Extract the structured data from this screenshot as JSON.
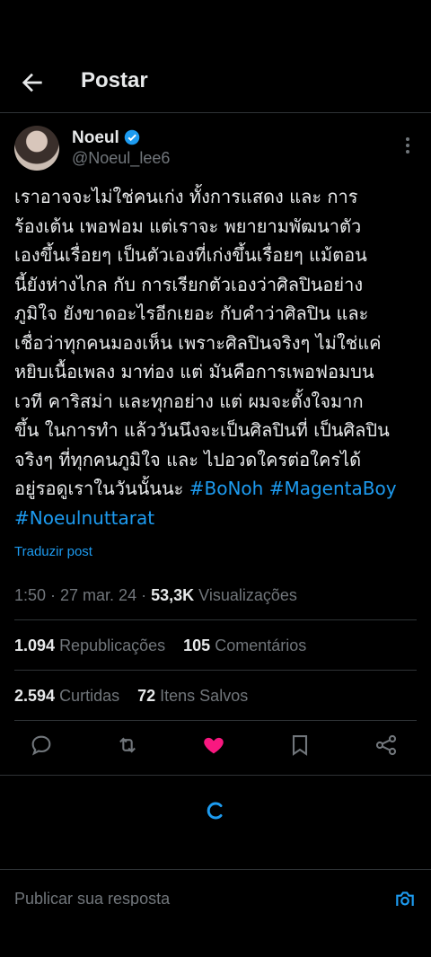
{
  "header": {
    "title": "Postar"
  },
  "author": {
    "name": "Noeul",
    "handle": "@Noeul_lee6"
  },
  "tweet": {
    "lines": [
      "เราอาจจะไม่ใช่คนเก่ง ทั้งการแสดง และ การ",
      "ร้องเต้น เพอฟอม แต่เราจะ พยายามพัฒนาตัว",
      "เองขึ้นเรื่อยๆ เป็นตัวเองที่เก่งขึ้นเรื่อยๆ แม้ตอน",
      "นี้ยังห่างไกล กับ การเรียกตัวเองว่าศิลปินอย่าง",
      "ภูมิใจ ยังขาดอะไรอีกเยอะ กับคำว่าศิลปิน และ",
      "เชื่อว่าทุกคนมองเห็น เพราะศิลปินจริงๆ ไม่ใช่แค่",
      "หยิบเนื้อเพลง มาท่อง แต่ มันคือการเพอฟอมบน",
      "เวที คาริสม่า และทุกอย่าง แต่ ผมจะตั้งใจมาก",
      "ขึ้น ในการทำ แล้ววันนึงจะเป็นศิลปินที่ เป็นศิลปิน",
      "จริงๆ ที่ทุกคนภูมิใจ และ ไปอวดใครต่อใครได้"
    ],
    "last_line_text": "อยู่รอดูเราในวันนั้นนะ ",
    "hashtag1": "#BoNoh",
    "hashtag2": "#MagentaBoy",
    "hashtag3": "#Noeulnuttarat"
  },
  "translate_label": "Traduzir post",
  "meta": {
    "time_date": "1:50 · 27 mar. 24 · ",
    "views_count": "53,3K",
    "views_label": "Visualizações"
  },
  "stats": {
    "reposts_count": "1.094",
    "reposts_label": "Republicações",
    "comments_count": "105",
    "comments_label": "Comentários",
    "likes_count": "2.594",
    "likes_label": "Curtidas",
    "saves_count": "72",
    "saves_label": "Itens Salvos"
  },
  "reply_placeholder": "Publicar sua resposta",
  "colors": {
    "accent": "#1d9bf0",
    "like": "#f91880",
    "muted": "#71767b",
    "text": "#e7e9ea",
    "divider": "#2f3336"
  },
  "icons": [
    "back-arrow-icon",
    "verified-icon",
    "more-vertical-icon",
    "reply-icon",
    "repost-icon",
    "like-icon",
    "bookmark-icon",
    "share-icon",
    "loading-spinner-icon",
    "camera-icon"
  ]
}
